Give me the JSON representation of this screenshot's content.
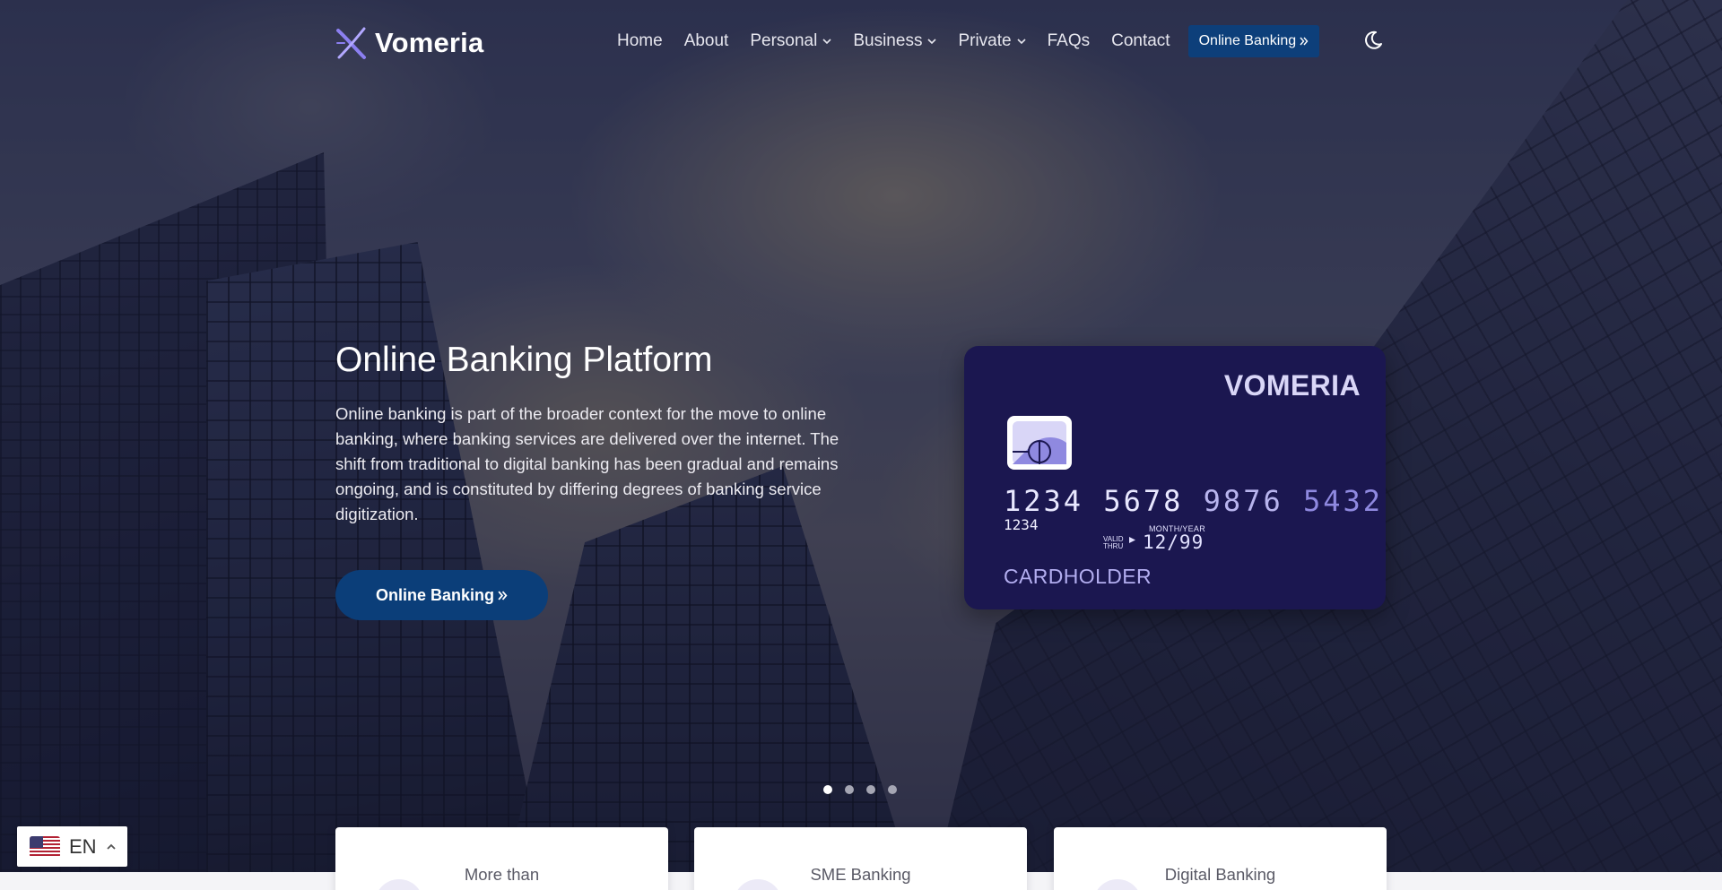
{
  "brand": {
    "name": "Vomeria"
  },
  "nav": {
    "items": [
      {
        "label": "Home",
        "dropdown": false
      },
      {
        "label": "About",
        "dropdown": false
      },
      {
        "label": "Personal",
        "dropdown": true
      },
      {
        "label": "Business",
        "dropdown": true
      },
      {
        "label": "Private",
        "dropdown": true
      },
      {
        "label": "FAQs",
        "dropdown": false
      },
      {
        "label": "Contact",
        "dropdown": false
      }
    ],
    "cta_label": "Online Banking",
    "theme_icon": "moon-icon"
  },
  "hero": {
    "title": "Online Banking Platform",
    "description": "Online banking is part of the broader context for the move to online banking, where banking services are delivered over the internet. The shift from traditional to digital banking has been gradual and remains ongoing, and is constituted by differing degrees of banking service digitization.",
    "button_label": "Online Banking"
  },
  "card": {
    "brand": "VOMERIA",
    "number_groups": [
      "1234",
      "5678",
      "9876",
      "5432"
    ],
    "small_number": "1234",
    "valid_thru_line1": "VALID",
    "valid_thru_line2": "THRU",
    "month_year_label": "MONTH/YEAR",
    "expiry": "12/99",
    "holder": "CARDHOLDER"
  },
  "carousel": {
    "slide_count": 4,
    "active_index": 0
  },
  "services": [
    {
      "label": "More than"
    },
    {
      "label": "SME Banking"
    },
    {
      "label": "Digital Banking"
    }
  ],
  "language": {
    "code": "EN",
    "flag": "us-flag-icon"
  },
  "colors": {
    "accent": "#0b3e79",
    "card_bg": "#1b1750",
    "card_accent": "#8f89e0"
  }
}
